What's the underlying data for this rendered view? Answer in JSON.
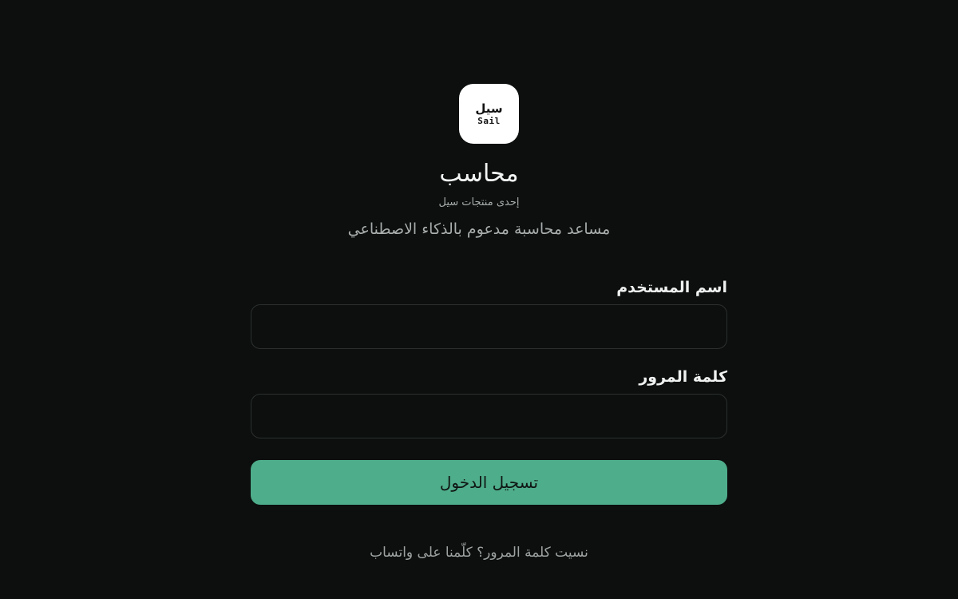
{
  "brand": {
    "logo_text_ar": "سيل",
    "logo_text_en": "Sail",
    "title": "محاسب",
    "subtitle": "إحدى منتجات سيل",
    "tagline": "مساعد محاسبة مدعوم بالذكاء الاصطناعي"
  },
  "login_form": {
    "username_label": "اسم المستخدم",
    "username_value": "",
    "password_label": "كلمة المرور",
    "password_value": "",
    "submit_label": "تسجيل الدخول"
  },
  "footer": {
    "help_text": "نسيت كلمة المرور؟ كلّمنا على واتساب"
  },
  "colors": {
    "background": "#0c0f0e",
    "accent": "#4ead8b",
    "input_border": "#2b302e"
  }
}
